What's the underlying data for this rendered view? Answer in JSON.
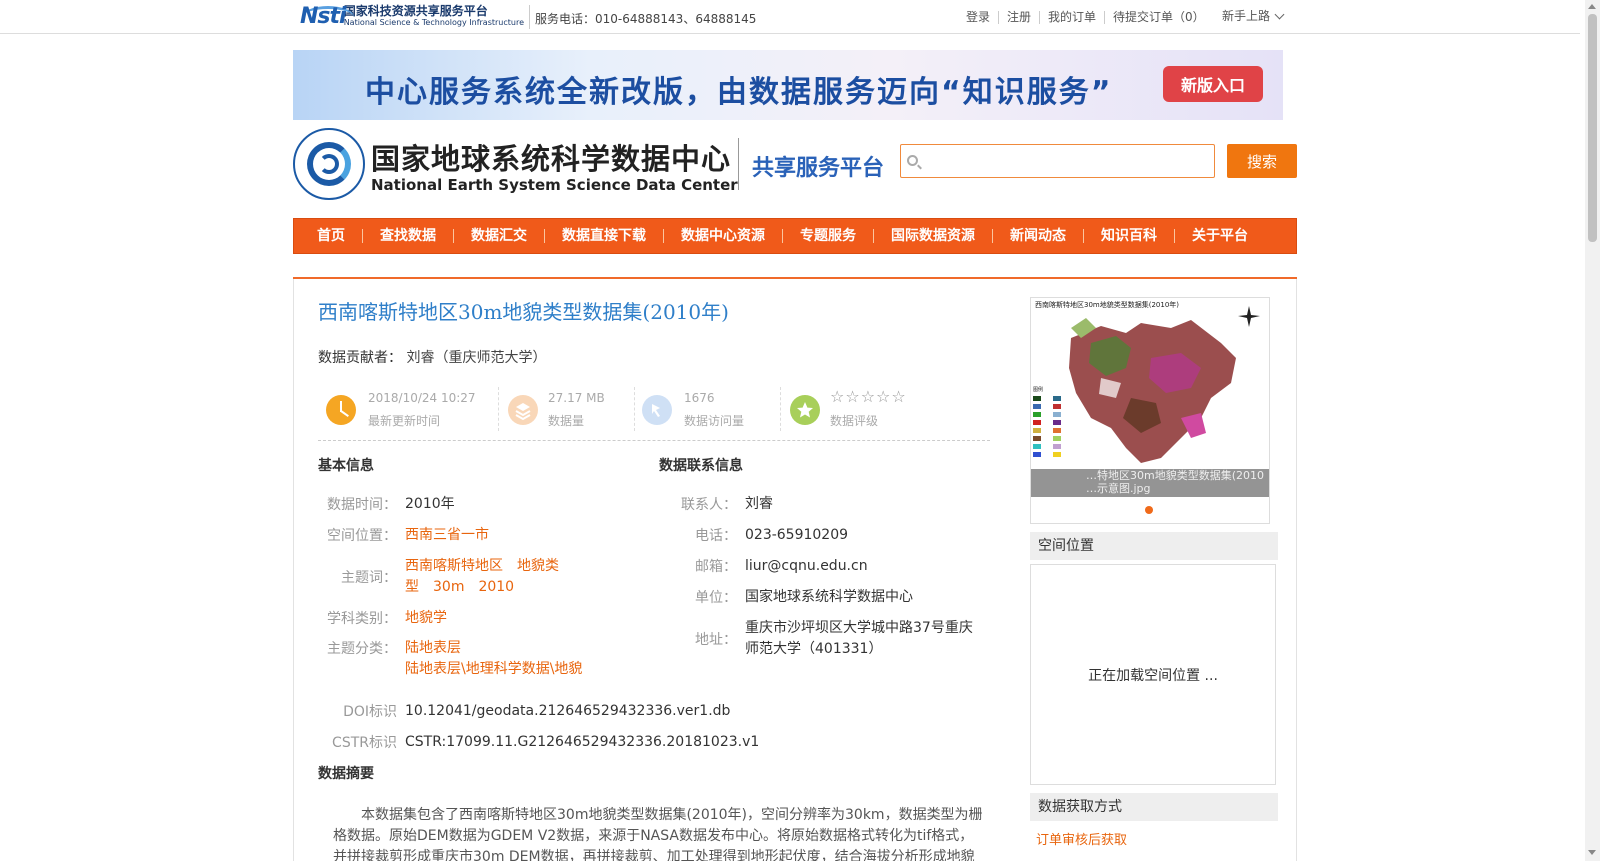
{
  "topbar": {
    "logo_cn": "国家科技资源共享服务平台",
    "logo_en": "National Science & Technology Infrastructure",
    "logo_mark": "Nsti",
    "service_phone": "服务电话：010-64888143、64888145",
    "links": [
      "登录",
      "注册",
      "我的订单",
      "待提交订单（0）"
    ],
    "newbie": "新手上路"
  },
  "banner": {
    "text": "中心服务系统全新改版，由数据服务迈向“知识服务”",
    "button": "新版入口"
  },
  "header": {
    "center_cn": "国家地球系统科学数据中心",
    "center_en": "National Earth System Science Data Center",
    "platform": "共享服务平台",
    "search_placeholder": "",
    "search_button": "搜索"
  },
  "nav": {
    "items": [
      "首页",
      "查找数据",
      "数据汇交",
      "数据直接下载",
      "数据中心资源",
      "专题服务",
      "国际数据资源",
      "新闻动态",
      "知识百科",
      "关于平台"
    ]
  },
  "dataset": {
    "title": "西南喀斯特地区30m地貌类型数据集(2010年)",
    "contributor_label": "数据贡献者：",
    "contributor": "刘睿（重庆师范大学）",
    "stats": {
      "update_time": "2018/10/24 10:27",
      "update_label": "最新更新时间",
      "size": "27.17 MB",
      "size_label": "数据量",
      "visits": "1676",
      "visits_label": "数据访问量",
      "rating_label": "数据评级",
      "rating_stars": "☆☆☆☆☆"
    },
    "basic_title": "基本信息",
    "basic": {
      "time_label": "数据时间：",
      "time": "2010年",
      "location_label": "空间位置：",
      "location": "西南三省一市",
      "keywords_label": "主题词：",
      "keywords_line1": "西南喀斯特地区　地貌类",
      "keywords_line2": "型　30m　2010",
      "subject_label": "学科类别：",
      "subject": "地貌学",
      "category_label": "主题分类：",
      "category_line1": "陆地表层",
      "category_line2": "陆地表层\\地理科学数据\\地貌",
      "doi_label": "DOI标识",
      "doi": "10.12041/geodata.212646529432336.ver1.db",
      "cstr_label": "CSTR标识",
      "cstr": "CSTR:17099.11.G212646529432336.20181023.v1"
    },
    "contact_title": "数据联系信息",
    "contact": {
      "person_label": "联系人：",
      "person": "刘睿",
      "phone_label": "电话：",
      "phone": "023-65910209",
      "email_label": "邮箱：",
      "email": "liur@cqnu.edu.cn",
      "org_label": "单位：",
      "org": "国家地球系统科学数据中心",
      "addr_label": "地址：",
      "addr_line1": "重庆市沙坪坝区大学城中路37号重庆",
      "addr_line2": "师范大学（401331）"
    },
    "abstract_title": "数据摘要",
    "abstract": "本数据集包含了西南喀斯特地区30m地貌类型数据集(2010年)，空间分辨率为30km，数据类型为栅格数据。原始DEM数据为GDEM V2数据，来源于NASA数据发布中心。将原始数据格式转化为tif格式，并拼接裁剪形成重庆市30m DEM数据，再拼接裁剪、加工处理得到地形起伏度，结合海拔分析形成地貌类型数"
  },
  "sidebar": {
    "thumb_title": "西南喀斯特地区30m地貌类型数据集(2010年)",
    "thumb_legend_label": "图例",
    "thumb_caption_line1": "…特地区30m地貌类型数据集(2010",
    "thumb_caption_line2": "…示意图.jpg",
    "spatial_title": "空间位置",
    "spatial_loading": "正在加载空间位置 ...",
    "access_title": "数据获取方式",
    "access_link": "订单审核后获取"
  },
  "colors": {
    "accent": "#f05a1a",
    "link": "#e8650e",
    "title": "#2f7fc9"
  }
}
